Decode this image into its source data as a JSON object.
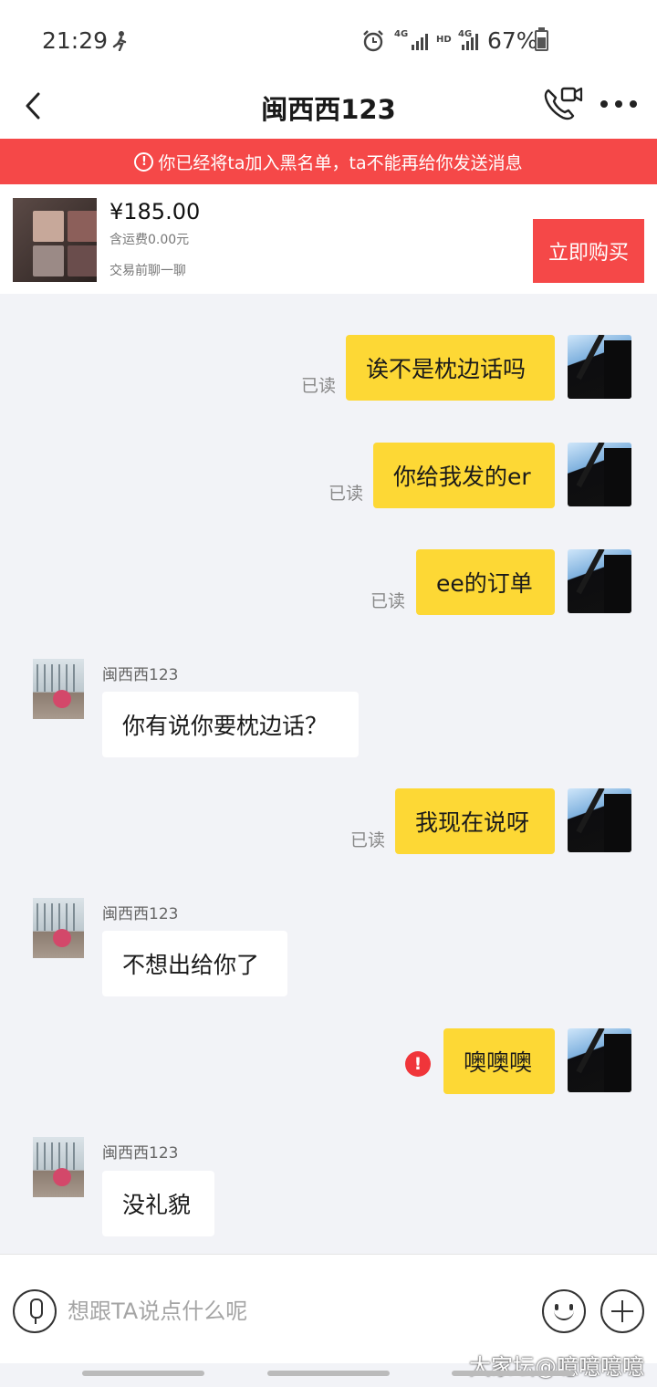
{
  "status": {
    "time": "21:29",
    "battery": "67%",
    "net1": "4G",
    "net2": "HD",
    "net3": "4G"
  },
  "header": {
    "title": "闽西西123"
  },
  "banner": {
    "text": "你已经将ta加入黑名单，ta不能再给你发送消息"
  },
  "product": {
    "price": "¥185.00",
    "shipping": "含运费0.00元",
    "tip": "交易前聊一聊",
    "buy_label": "立即购买"
  },
  "messages": [
    {
      "from": "me",
      "text": "诶不是枕边话吗",
      "status": "已读"
    },
    {
      "from": "me",
      "text": "你给我发的er",
      "status": "已读"
    },
    {
      "from": "me",
      "text": "ee的订单",
      "status": "已读"
    },
    {
      "from": "them",
      "sender": "闽西西123",
      "text": "你有说你要枕边话？"
    },
    {
      "from": "me",
      "text": "我现在说呀",
      "status": "已读"
    },
    {
      "from": "them",
      "sender": "闽西西123",
      "text": "不想出给你了"
    },
    {
      "from": "me",
      "text": "噢噢噢",
      "status": "failed"
    },
    {
      "from": "them",
      "sender": "闽西西123",
      "text": "没礼貌"
    }
  ],
  "input": {
    "placeholder": "想跟TA说点什么呢"
  },
  "watermark": "大家坛@噫噫噫噫",
  "colors": {
    "accent_red": "#f54848",
    "my_bubble": "#fdd835",
    "background": "#f2f3f7"
  }
}
